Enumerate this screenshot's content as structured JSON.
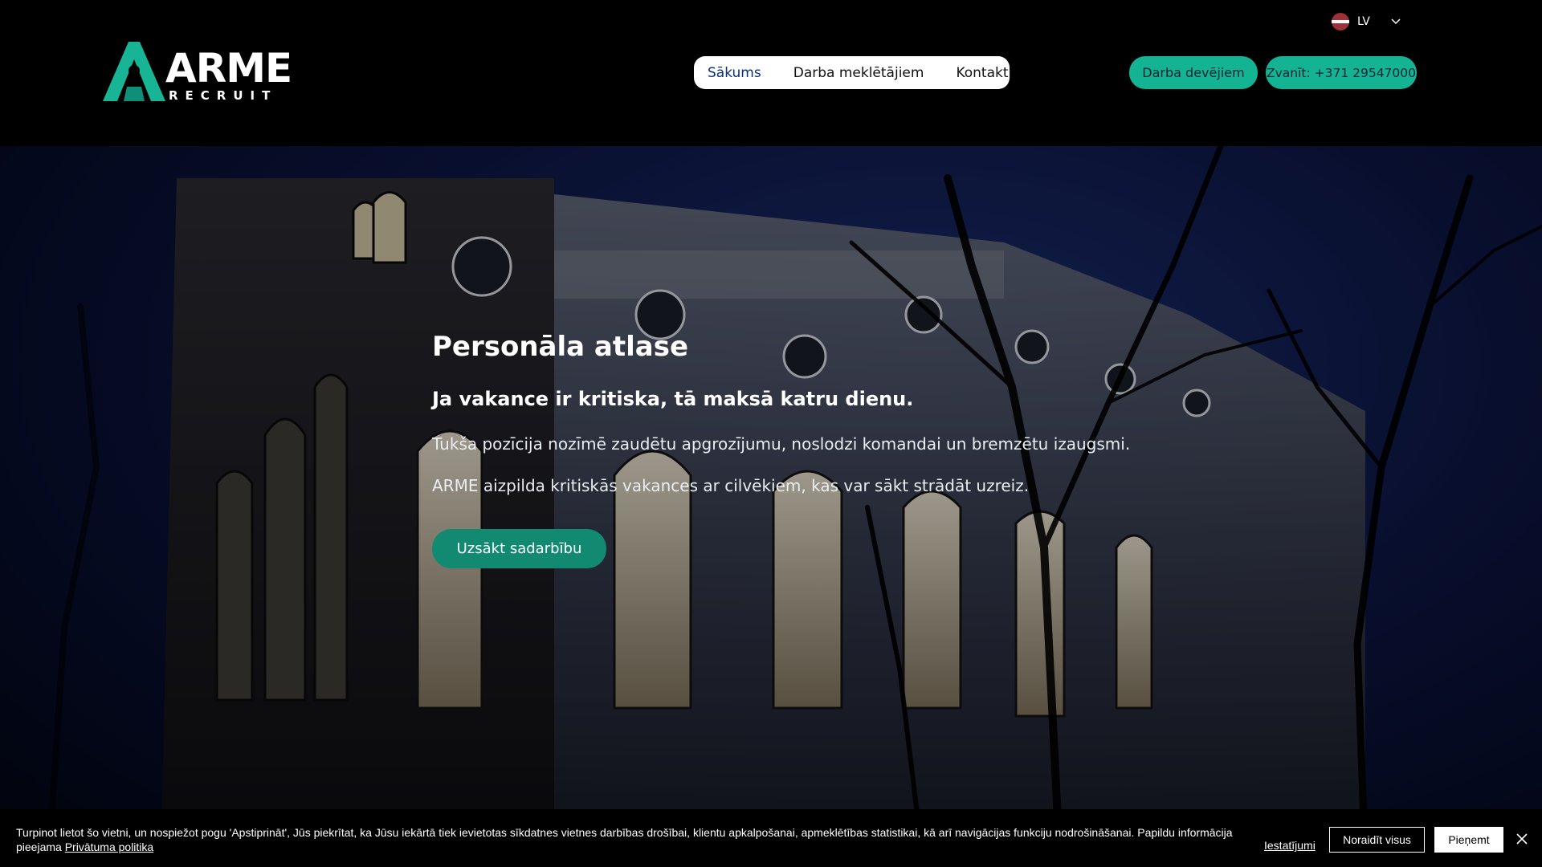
{
  "header": {
    "logo": {
      "word": "ARME",
      "sub": "RECRUIT"
    },
    "nav": [
      {
        "label": "Sākums",
        "active": true
      },
      {
        "label": "Darba meklētājiem",
        "active": false
      },
      {
        "label": "Kontakti",
        "active": false
      }
    ],
    "cta_employers": "Darba devējiem",
    "cta_call": "Zvanīt: +371 29547000",
    "language": {
      "label": "LV",
      "flag_icon": "latvia-flag-icon",
      "chevron_icon": "chevron-down-icon"
    }
  },
  "hero": {
    "title": "Personāla atlase",
    "subtitle": "Ja vakance ir kritiska, tā maksā katru dienu.",
    "paragraph1": "Tukša pozīcija nozīmē zaudētu apgrozījumu, noslodzi komandai un bremzētu izaugsmi.",
    "paragraph2": "ARME aizpilda kritiskās vakances ar cilvēkiem, kas var sākt strādāt uzreiz.",
    "button": "Uzsākt sadarbību"
  },
  "cookie_bar": {
    "text": "Turpinot lietot šo vietni, un nospiežot pogu 'Apstiprināt', Jūs piekrītat, ka Jūsu iekārtā tiek ievietotas sīkdatnes vietnes darbības drošībai, klientu apkalpošanai, apmeklētības statistikai, kā arī navigācijas funkciju nodrošināšanai. Papildu informācija pieejama",
    "privacy_link": "Privātuma politika",
    "settings": "Iestatījumi",
    "reject": "Noraidīt visus",
    "accept": "Pieņemt",
    "close_icon": "close-icon"
  },
  "colors": {
    "accent": "#14b394",
    "hero_button": "#128a72",
    "header_bg": "#000000",
    "night_sky": "#0c1540"
  }
}
